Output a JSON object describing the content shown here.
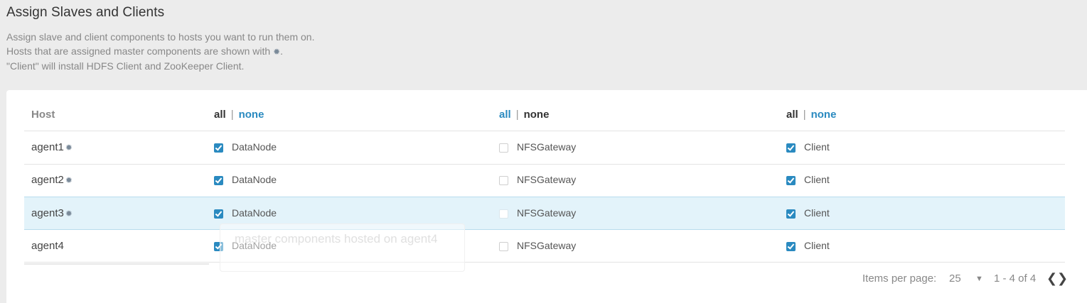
{
  "title": "Assign Slaves and Clients",
  "description": {
    "line1": "Assign slave and client components to hosts you want to run them on.",
    "line2_prefix": "Hosts that are assigned master components are shown with",
    "line2_suffix": ".",
    "line3": "\"Client\" will install HDFS Client and ZooKeeper Client."
  },
  "table": {
    "host_header": "Host",
    "columns": [
      {
        "all": "all",
        "sep": "|",
        "none": "none"
      },
      {
        "all": "all",
        "sep": "|",
        "none": "none"
      },
      {
        "all": "all",
        "sep": "|",
        "none": "none"
      }
    ],
    "component_labels": [
      "DataNode",
      "NFSGateway",
      "Client"
    ],
    "rows": [
      {
        "host": "agent1",
        "master": true,
        "checks": [
          true,
          false,
          true
        ]
      },
      {
        "host": "agent2",
        "master": true,
        "checks": [
          true,
          false,
          true
        ]
      },
      {
        "host": "agent3",
        "master": true,
        "checks": [
          true,
          false,
          true
        ],
        "highlighted": true
      },
      {
        "host": "agent4",
        "master": false,
        "checks": [
          true,
          false,
          true
        ]
      }
    ]
  },
  "tooltip": "master components hosted on agent4",
  "pagination": {
    "label": "Items per page:",
    "page_size": "25",
    "range": "1 - 4 of 4"
  },
  "icons": {
    "master": "asterisk-icon",
    "prev": "chevron-left-icon",
    "next": "chevron-right-icon",
    "dropdown": "caret-down-icon"
  },
  "colors": {
    "accent": "#2a8ac0",
    "highlight_row": "#e3f3fa",
    "background": "#ececec"
  }
}
